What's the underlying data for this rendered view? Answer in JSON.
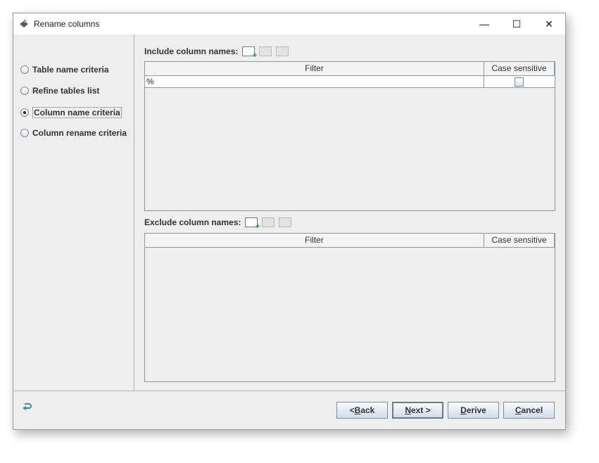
{
  "window": {
    "title": "Rename columns",
    "minimize": "—",
    "maximize": "☐",
    "close": "✕"
  },
  "sidebar": {
    "items": [
      {
        "label": "Table name criteria",
        "selected": false
      },
      {
        "label": "Refine tables list",
        "selected": false
      },
      {
        "label": "Column name criteria",
        "selected": true
      },
      {
        "label": "Column rename criteria",
        "selected": false
      }
    ]
  },
  "include": {
    "label": "Include column names:",
    "headers": [
      "Filter",
      "Case sensitive"
    ],
    "rows": [
      {
        "filter": "%",
        "case_sensitive": false
      }
    ]
  },
  "exclude": {
    "label": "Exclude column names:",
    "headers": [
      "Filter",
      "Case sensitive"
    ]
  },
  "buttons": {
    "back": {
      "pre": "< ",
      "key": "B",
      "post": "ack"
    },
    "next": {
      "pre": "",
      "key": "N",
      "post": "ext >"
    },
    "derive": {
      "pre": "",
      "key": "D",
      "post": "erive"
    },
    "cancel": {
      "pre": "",
      "key": "C",
      "post": "ancel"
    }
  },
  "icons": [
    "add-icon",
    "edit-icon",
    "remove-icon",
    "undo-icon"
  ]
}
